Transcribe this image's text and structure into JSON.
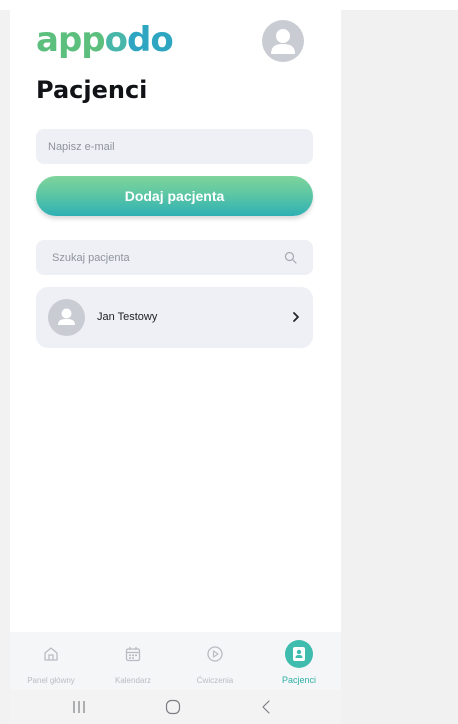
{
  "brand": {
    "logo_letters": [
      "a",
      "p",
      "p",
      "o",
      "d",
      "o"
    ],
    "colors": [
      "#5cbf7d",
      "#5cbf7d",
      "#5cbf7d",
      "#48b7a9",
      "#2ea6c1",
      "#2ea6c1"
    ]
  },
  "header": {
    "title": "Pacjenci",
    "avatar_icon": "user-icon"
  },
  "form": {
    "email_placeholder": "Napisz e-mail",
    "email_value": "",
    "add_button_label": "Dodaj pacjenta"
  },
  "search": {
    "placeholder": "Szukaj pacjenta",
    "value": "",
    "icon": "search-icon"
  },
  "patients": [
    {
      "name": "Jan Testowy",
      "avatar_icon": "user-icon",
      "arrow_icon": "chevron-right-icon"
    }
  ],
  "bottom_nav": {
    "items": [
      {
        "label": "Panel główny",
        "icon": "home-icon",
        "active": false
      },
      {
        "label": "Kalendarz",
        "icon": "calendar-icon",
        "active": false
      },
      {
        "label": "Ćwiczenia",
        "icon": "play-icon",
        "active": false
      },
      {
        "label": "Pacjenci",
        "icon": "patients-icon",
        "active": true
      }
    ]
  },
  "theme": {
    "accent": "#3fbcae",
    "field_background": "#eef0f5",
    "inactive_nav": "#b9bcc3"
  }
}
